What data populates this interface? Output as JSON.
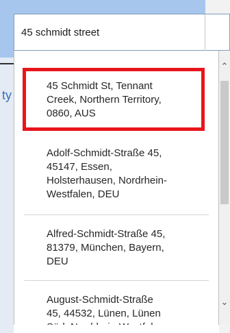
{
  "search": {
    "value": "45 schmidt street"
  },
  "background": {
    "left_fragment": "ty"
  },
  "suggestions": [
    {
      "lines": [
        "45 Schmidt St, Tennant",
        "Creek, Northern Territory,",
        "0860, AUS"
      ]
    },
    {
      "lines": [
        "Adolf-Schmidt-Straße 45,",
        "45147, Essen,",
        "Holsterhausen, Nordrhein-",
        "Westfalen, DEU"
      ]
    },
    {
      "lines": [
        "Alfred-Schmidt-Straße 45,",
        "81379, München, Bayern,",
        "DEU"
      ]
    },
    {
      "lines": [
        "August-Schmidt-Straße",
        "45, 44532, Lünen, Lünen",
        "Süd, Nordrhein-Westfalen"
      ]
    }
  ],
  "scrollbar": {
    "up_icon": "chevron-up-icon",
    "down_icon": "chevron-down-icon"
  },
  "colors": {
    "highlight": "#e8151b",
    "top_band": "#a6c6ee"
  }
}
